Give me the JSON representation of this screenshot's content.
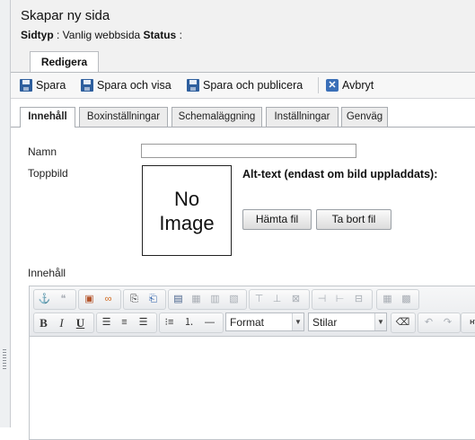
{
  "header": {
    "title": "Skapar ny sida",
    "sidtyp_label": "Sidtyp",
    "sidtyp_value": ": Vanlig webbsida",
    "status_label": "Status",
    "status_value": ":"
  },
  "main_tab": {
    "label": "Redigera"
  },
  "toolbar": {
    "save": "Spara",
    "save_view": "Spara och visa",
    "save_publish": "Spara och publicera",
    "cancel": "Avbryt"
  },
  "sub_tabs": [
    "Innehåll",
    "Boxinställningar",
    "Schemaläggning",
    "Inställningar",
    "Genväg"
  ],
  "form": {
    "name_label": "Namn",
    "name_value": "",
    "top_image_label": "Toppbild",
    "no_image_line1": "No",
    "no_image_line2": "Image",
    "alt_text_label": "Alt-text (endast om bild uppladdats):",
    "fetch_button": "Hämta fil",
    "remove_button": "Ta bort fil",
    "content_label": "Innehåll"
  },
  "editor": {
    "format_label": "Format",
    "styles_label": "Stilar",
    "bold": "B",
    "italic": "I",
    "underline": "U",
    "html_label": "HTML"
  }
}
